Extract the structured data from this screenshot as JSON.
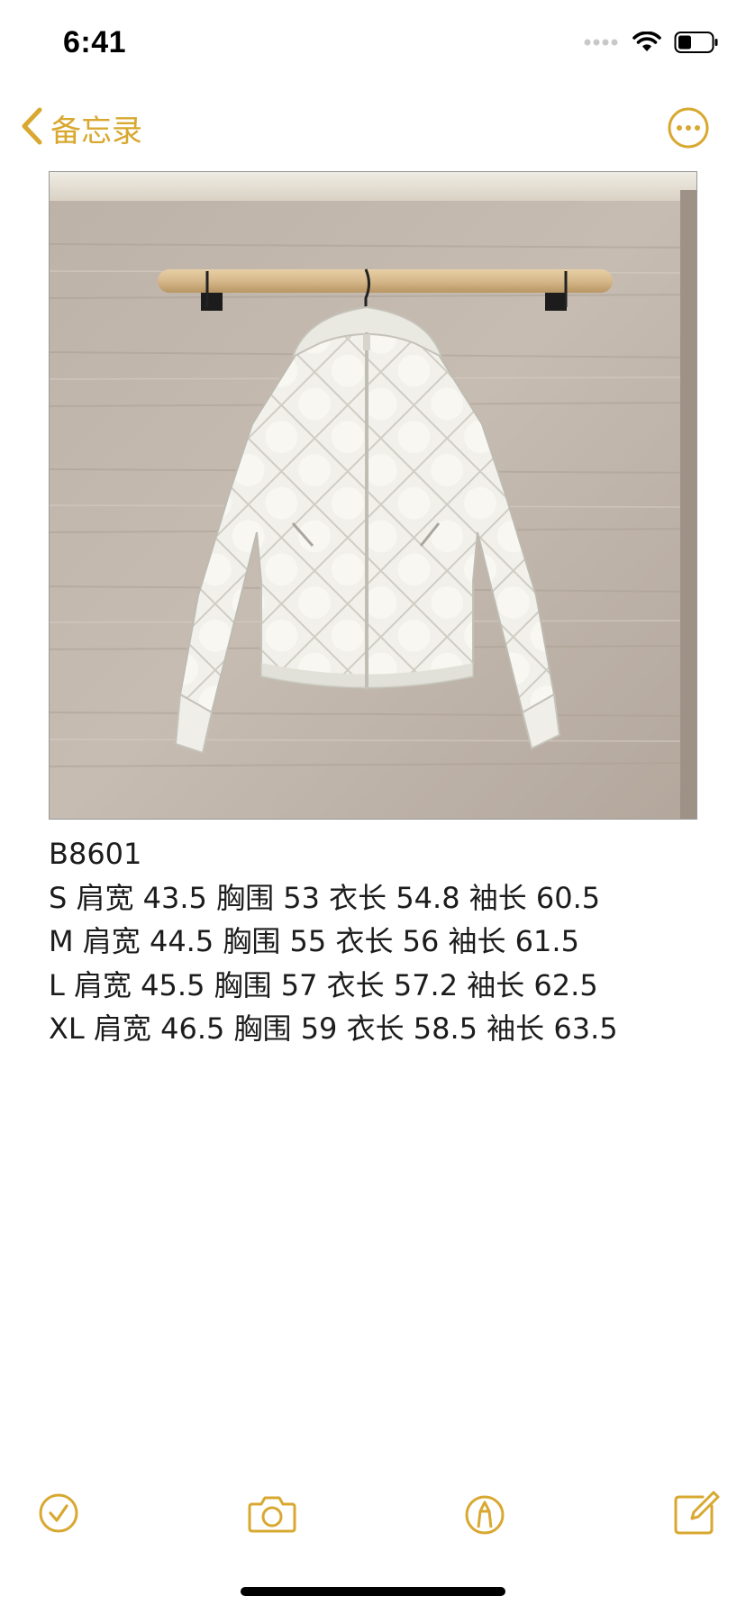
{
  "status_bar": {
    "time": "6:41"
  },
  "nav": {
    "back_label": "备忘录",
    "accent_color": "#d8a830"
  },
  "note": {
    "image": "white quilted down jacket with hood hanging on wooden rail against beige travertine wall",
    "lines": [
      "B8601",
      "S 肩宽 43.5 胸围 53 衣长 54.8 袖长 60.5",
      "M 肩宽 44.5 胸围 55 衣长 56 袖长 61.5",
      "L 肩宽 45.5 胸围 57 衣长 57.2 袖长 62.5",
      "XL 肩宽 46.5 胸围 59 衣长 58.5 袖长 63.5"
    ]
  },
  "toolbar": {
    "icons": [
      "checklist-icon",
      "camera-icon",
      "markup-icon",
      "compose-icon"
    ]
  }
}
